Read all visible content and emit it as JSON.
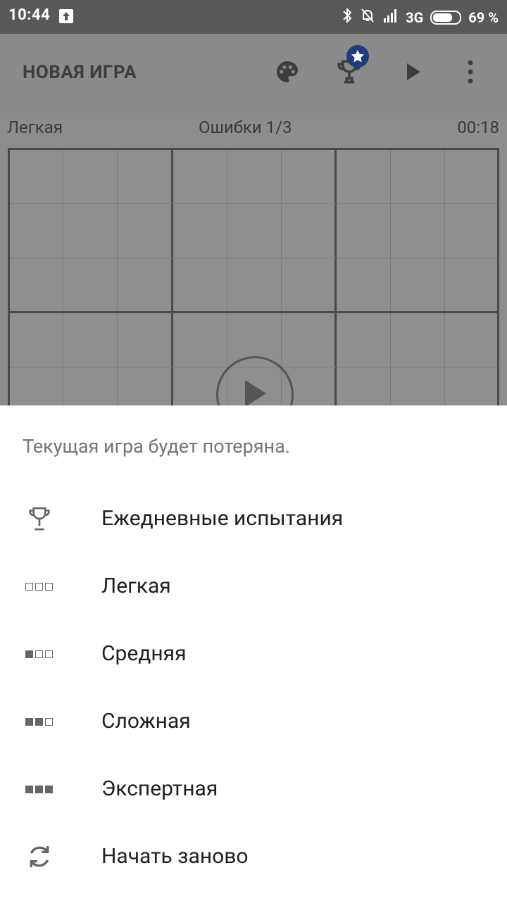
{
  "status_bar": {
    "time": "10:44",
    "network": "3G",
    "battery": "69 %"
  },
  "app_bar": {
    "title": "НОВАЯ ИГРА",
    "icons": [
      "palette-icon",
      "trophy-icon",
      "play-icon",
      "more-vert-icon"
    ]
  },
  "game_info": {
    "difficulty": "Легкая",
    "mistakes": "Ошибки 1/3",
    "timer": "00:18"
  },
  "sheet": {
    "subtitle": "Текущая игра будет потеряна.",
    "items": [
      {
        "label": "Ежедневные испытания",
        "icon": "trophy-icon"
      },
      {
        "label": "Легкая",
        "icon": "difficulty-0-icon"
      },
      {
        "label": "Средняя",
        "icon": "difficulty-1-icon"
      },
      {
        "label": "Сложная",
        "icon": "difficulty-2-icon"
      },
      {
        "label": "Экспертная",
        "icon": "difficulty-3-icon"
      },
      {
        "label": "Начать заново",
        "icon": "restart-icon"
      }
    ]
  },
  "colors": {
    "scrim": "#8a8a8a",
    "badge": "#1f3b7a",
    "text_primary": "#212121",
    "text_secondary": "#757575"
  }
}
